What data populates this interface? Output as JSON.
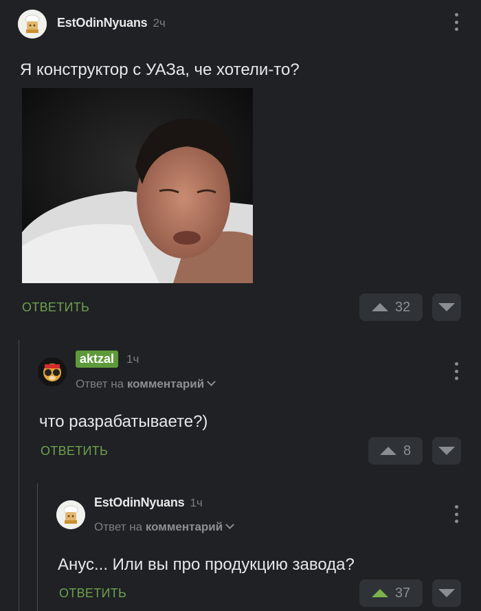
{
  "comments": [
    {
      "username": "EstOdinNyuans",
      "time": "2ч",
      "text": "Я конструктор с УАЗа, че хотели-то?",
      "reply_label": "ОТВЕТИТЬ",
      "score": "32",
      "avatar_icon": "chef-avatar-icon"
    },
    {
      "username": "aktzal",
      "time": "1ч",
      "reply_to_prefix": "Ответ на",
      "reply_to_target": "комментарий",
      "text": "что разрабатываете?)",
      "reply_label": "ОТВЕТИТЬ",
      "score": "8",
      "avatar_icon": "monkey-avatar-icon"
    },
    {
      "username": "EstOdinNyuans",
      "time": "1ч",
      "reply_to_prefix": "Ответ на",
      "reply_to_target": "комментарий",
      "text": "Анус... Или вы про продукцию завода?",
      "reply_label": "ОТВЕТИТЬ",
      "score": "37",
      "score_upvoted": true,
      "avatar_icon": "chef-avatar-icon"
    }
  ],
  "colors": {
    "background": "#1f2124",
    "accent_green": "#6fa04e",
    "badge_green": "#5e9a3b",
    "muted": "#7b7f84"
  }
}
